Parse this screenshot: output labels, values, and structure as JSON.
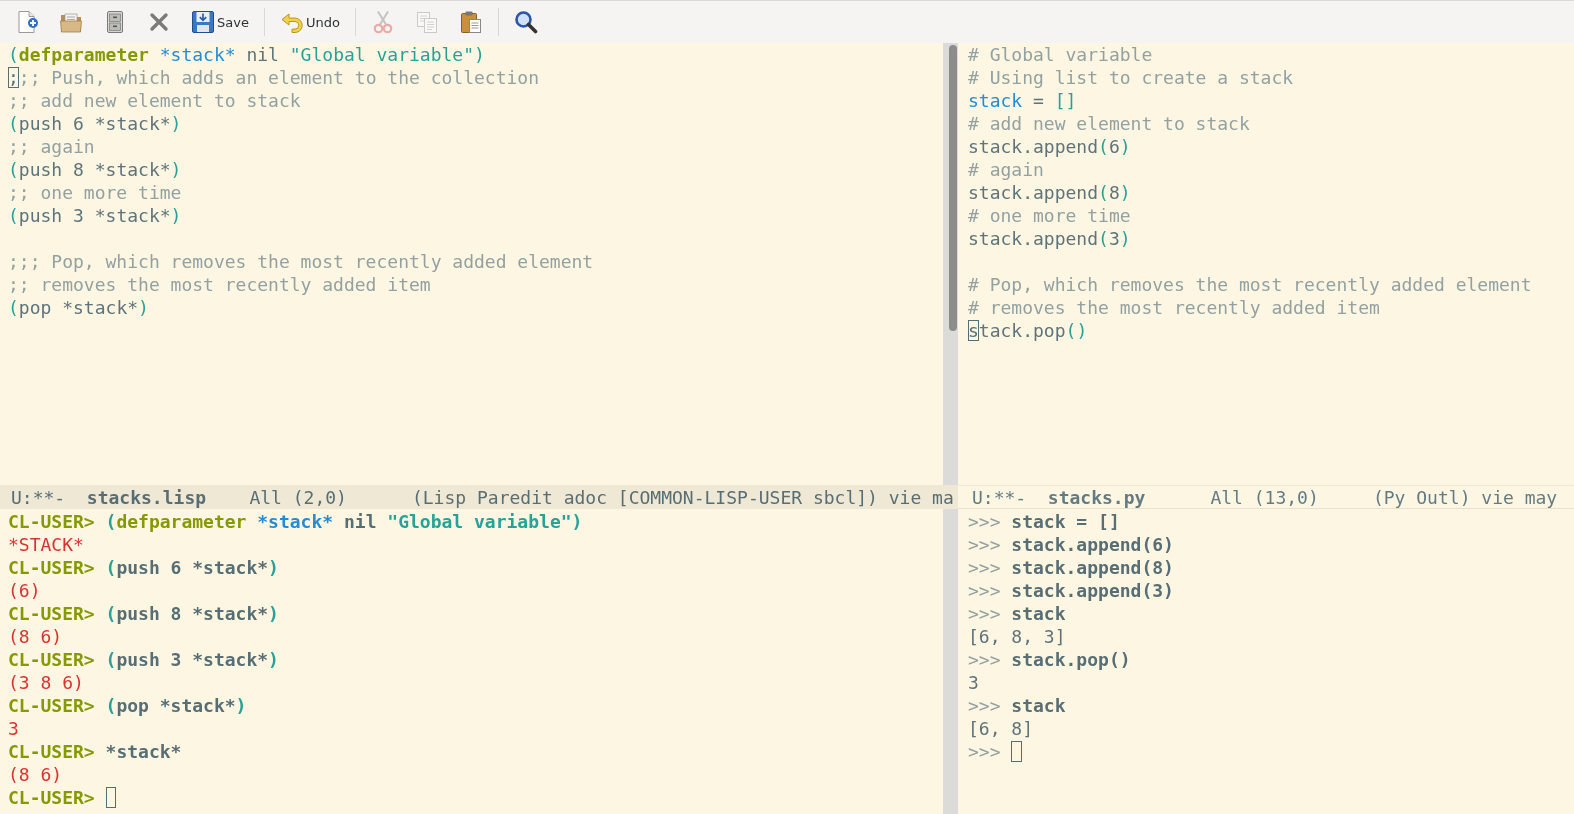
{
  "toolbar": {
    "groups": [
      {
        "buttons": [
          {
            "kind": "new-file",
            "disabled": false
          },
          {
            "kind": "open-file",
            "disabled": false
          },
          {
            "kind": "open-directory",
            "disabled": false
          },
          {
            "kind": "close-buffer",
            "disabled": false
          },
          {
            "kind": "save",
            "label": "Save",
            "disabled": false
          }
        ]
      },
      {
        "buttons": [
          {
            "kind": "undo",
            "label": "Undo",
            "disabled": false
          }
        ]
      },
      {
        "buttons": [
          {
            "kind": "cut",
            "disabled": true
          },
          {
            "kind": "copy",
            "disabled": true
          },
          {
            "kind": "paste",
            "disabled": false
          }
        ]
      },
      {
        "buttons": [
          {
            "kind": "search",
            "disabled": false
          }
        ]
      }
    ]
  },
  "windows": {
    "top_left": {
      "lines": [
        {
          "kind": "code",
          "tokens": [
            {
              "text": "(",
              "kind": "paren"
            },
            {
              "text": "defparameter",
              "kind": "keyword"
            },
            {
              "text": " *stack*",
              "kind": "variable"
            },
            {
              "text": " nil ",
              "kind": "plain"
            },
            {
              "text": "\"Global variable\"",
              "kind": "string"
            },
            {
              "text": ")",
              "kind": "paren"
            }
          ]
        },
        {
          "kind": "code",
          "tokens": [
            {
              "text": ";",
              "kind": "cursor"
            },
            {
              "text": ";; Push, which adds an element to the collection",
              "kind": "comment"
            }
          ]
        },
        {
          "kind": "code",
          "tokens": [
            {
              "text": ";; add new element to stack",
              "kind": "comment"
            }
          ]
        },
        {
          "kind": "code",
          "tokens": [
            {
              "text": "(",
              "kind": "paren"
            },
            {
              "text": "push 6 *stack*",
              "kind": "plain"
            },
            {
              "text": ")",
              "kind": "paren"
            }
          ]
        },
        {
          "kind": "code",
          "tokens": [
            {
              "text": ";; again",
              "kind": "comment"
            }
          ]
        },
        {
          "kind": "code",
          "tokens": [
            {
              "text": "(",
              "kind": "paren"
            },
            {
              "text": "push 8 *stack*",
              "kind": "plain"
            },
            {
              "text": ")",
              "kind": "paren"
            }
          ]
        },
        {
          "kind": "code",
          "tokens": [
            {
              "text": ";; one more time",
              "kind": "comment"
            }
          ]
        },
        {
          "kind": "code",
          "tokens": [
            {
              "text": "(",
              "kind": "paren"
            },
            {
              "text": "push 3 *stack*",
              "kind": "plain"
            },
            {
              "text": ")",
              "kind": "paren"
            }
          ]
        },
        {
          "kind": "blank"
        },
        {
          "kind": "code",
          "tokens": [
            {
              "text": ";;; Pop, which removes the most recently added element",
              "kind": "comment"
            }
          ]
        },
        {
          "kind": "code",
          "tokens": [
            {
              "text": ";; removes the most recently added item",
              "kind": "comment"
            }
          ]
        },
        {
          "kind": "code",
          "tokens": [
            {
              "text": "(",
              "kind": "paren"
            },
            {
              "text": "pop *stack*",
              "kind": "plain"
            },
            {
              "text": ")",
              "kind": "paren"
            }
          ]
        }
      ],
      "mode_line": {
        "active": true,
        "status": "U:**-",
        "buffer": "stacks.lisp",
        "position": "All (2,0)",
        "modes": "(Lisp Paredit adoc [COMMON-LISP-USER sbcl]) vie ma"
      }
    },
    "top_right": {
      "lines": [
        {
          "kind": "code",
          "tokens": [
            {
              "text": "# Global variable",
              "kind": "comment"
            }
          ]
        },
        {
          "kind": "code",
          "tokens": [
            {
              "text": "# Using list to create a stack",
              "kind": "comment"
            }
          ]
        },
        {
          "kind": "code",
          "tokens": [
            {
              "text": "stack",
              "kind": "variable"
            },
            {
              "text": " = ",
              "kind": "plain"
            },
            {
              "text": "[]",
              "kind": "paren"
            }
          ]
        },
        {
          "kind": "code",
          "tokens": [
            {
              "text": "# add new element to stack",
              "kind": "comment"
            }
          ]
        },
        {
          "kind": "code",
          "tokens": [
            {
              "text": "stack.append",
              "kind": "plain"
            },
            {
              "text": "(",
              "kind": "paren"
            },
            {
              "text": "6",
              "kind": "plain"
            },
            {
              "text": ")",
              "kind": "paren"
            }
          ]
        },
        {
          "kind": "code",
          "tokens": [
            {
              "text": "# again",
              "kind": "comment"
            }
          ]
        },
        {
          "kind": "code",
          "tokens": [
            {
              "text": "stack.append",
              "kind": "plain"
            },
            {
              "text": "(",
              "kind": "paren"
            },
            {
              "text": "8",
              "kind": "plain"
            },
            {
              "text": ")",
              "kind": "paren"
            }
          ]
        },
        {
          "kind": "code",
          "tokens": [
            {
              "text": "# one more time",
              "kind": "comment"
            }
          ]
        },
        {
          "kind": "code",
          "tokens": [
            {
              "text": "stack.append",
              "kind": "plain"
            },
            {
              "text": "(",
              "kind": "paren"
            },
            {
              "text": "3",
              "kind": "plain"
            },
            {
              "text": ")",
              "kind": "paren"
            }
          ]
        },
        {
          "kind": "blank"
        },
        {
          "kind": "code",
          "tokens": [
            {
              "text": "# Pop, which removes the most recently added element",
              "kind": "comment"
            }
          ]
        },
        {
          "kind": "code",
          "tokens": [
            {
              "text": "# removes the most recently added item",
              "kind": "comment"
            }
          ]
        },
        {
          "kind": "code",
          "tokens": [
            {
              "text": "s",
              "kind": "cursor"
            },
            {
              "text": "tack.pop",
              "kind": "plain"
            },
            {
              "text": "()",
              "kind": "paren"
            }
          ]
        }
      ],
      "mode_line": {
        "active": false,
        "status": "U:**-",
        "buffer": "stacks.py",
        "position": "All (13,0)",
        "modes": "(Py Outl) vie may"
      }
    },
    "bottom_left": {
      "input_cursor": true,
      "lines": [
        {
          "kind": "input",
          "tokens": [
            {
              "text": "CL-USER>",
              "kind": "prompt"
            },
            {
              "text": " (",
              "kind": "paren"
            },
            {
              "text": "defparameter",
              "kind": "keyword"
            },
            {
              "text": " *stack*",
              "kind": "variable"
            },
            {
              "text": " nil ",
              "kind": "plain"
            },
            {
              "text": "\"Global variable\"",
              "kind": "string"
            },
            {
              "text": ")",
              "kind": "paren"
            }
          ]
        },
        {
          "kind": "output",
          "tokens": [
            {
              "text": "*STACK*",
              "kind": "result"
            }
          ]
        },
        {
          "kind": "input",
          "tokens": [
            {
              "text": "CL-USER>",
              "kind": "prompt"
            },
            {
              "text": " (",
              "kind": "paren"
            },
            {
              "text": "push 6 *stack*",
              "kind": "plain"
            },
            {
              "text": ")",
              "kind": "paren"
            }
          ]
        },
        {
          "kind": "output",
          "tokens": [
            {
              "text": "(6)",
              "kind": "result"
            }
          ]
        },
        {
          "kind": "input",
          "tokens": [
            {
              "text": "CL-USER>",
              "kind": "prompt"
            },
            {
              "text": " (",
              "kind": "paren"
            },
            {
              "text": "push 8 *stack*",
              "kind": "plain"
            },
            {
              "text": ")",
              "kind": "paren"
            }
          ]
        },
        {
          "kind": "output",
          "tokens": [
            {
              "text": "(8 6)",
              "kind": "result"
            }
          ]
        },
        {
          "kind": "input",
          "tokens": [
            {
              "text": "CL-USER>",
              "kind": "prompt"
            },
            {
              "text": " (",
              "kind": "paren"
            },
            {
              "text": "push 3 *stack*",
              "kind": "plain"
            },
            {
              "text": ")",
              "kind": "paren"
            }
          ]
        },
        {
          "kind": "output",
          "tokens": [
            {
              "text": "(3 8 6)",
              "kind": "result"
            }
          ]
        },
        {
          "kind": "input",
          "tokens": [
            {
              "text": "CL-USER>",
              "kind": "prompt"
            },
            {
              "text": " (",
              "kind": "paren"
            },
            {
              "text": "pop *stack*",
              "kind": "plain"
            },
            {
              "text": ")",
              "kind": "paren"
            }
          ]
        },
        {
          "kind": "output",
          "tokens": [
            {
              "text": "3",
              "kind": "result"
            }
          ]
        },
        {
          "kind": "input",
          "tokens": [
            {
              "text": "CL-USER>",
              "kind": "prompt"
            },
            {
              "text": " *stack*",
              "kind": "plain"
            }
          ]
        },
        {
          "kind": "output",
          "tokens": [
            {
              "text": "(8 6)",
              "kind": "result"
            }
          ]
        },
        {
          "kind": "input",
          "tokens": [
            {
              "text": "CL-USER>",
              "kind": "prompt"
            }
          ]
        }
      ]
    },
    "bottom_right": {
      "input_cursor": true,
      "lines": [
        {
          "kind": "input",
          "tokens": [
            {
              "text": ">>>",
              "kind": "pyprompt"
            },
            {
              "text": " stack = []",
              "kind": "plain"
            }
          ]
        },
        {
          "kind": "input",
          "tokens": [
            {
              "text": ">>>",
              "kind": "pyprompt"
            },
            {
              "text": " stack.append(6)",
              "kind": "plain"
            }
          ]
        },
        {
          "kind": "input",
          "tokens": [
            {
              "text": ">>>",
              "kind": "pyprompt"
            },
            {
              "text": " stack.append(8)",
              "kind": "plain"
            }
          ]
        },
        {
          "kind": "input",
          "tokens": [
            {
              "text": ">>>",
              "kind": "pyprompt"
            },
            {
              "text": " stack.append(3)",
              "kind": "plain"
            }
          ]
        },
        {
          "kind": "input",
          "tokens": [
            {
              "text": ">>>",
              "kind": "pyprompt"
            },
            {
              "text": " stack",
              "kind": "plain"
            }
          ]
        },
        {
          "kind": "output",
          "tokens": [
            {
              "text": "[6, 8, 3]",
              "kind": "plain"
            }
          ]
        },
        {
          "kind": "input",
          "tokens": [
            {
              "text": ">>>",
              "kind": "pyprompt"
            },
            {
              "text": " stack.pop()",
              "kind": "plain"
            }
          ]
        },
        {
          "kind": "output",
          "tokens": [
            {
              "text": "3",
              "kind": "plain"
            }
          ]
        },
        {
          "kind": "input",
          "tokens": [
            {
              "text": ">>>",
              "kind": "pyprompt"
            },
            {
              "text": " stack",
              "kind": "plain"
            }
          ]
        },
        {
          "kind": "output",
          "tokens": [
            {
              "text": "[6, 8]",
              "kind": "plain"
            }
          ]
        },
        {
          "kind": "input",
          "tokens": [
            {
              "text": ">>>",
              "kind": "pyprompt"
            }
          ]
        }
      ]
    }
  }
}
